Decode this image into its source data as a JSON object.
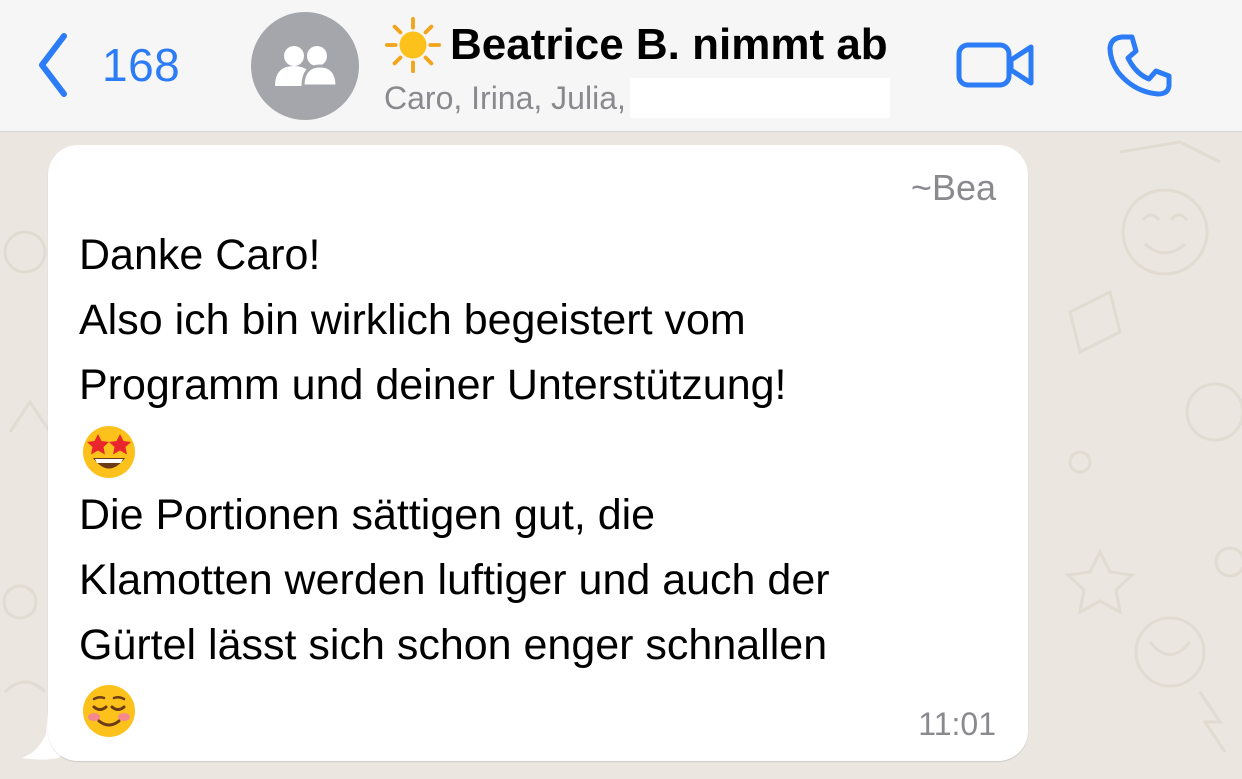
{
  "header": {
    "back_count": "168",
    "chat_title": "Beatrice B. nimmt ab",
    "title_emoji": "sun-emoji",
    "members_text": "Caro, Irina, Julia,",
    "avatar_icon": "group-icon"
  },
  "message": {
    "sender": "~Bea",
    "lines": [
      "Danke Caro!",
      "Also ich bin wirklich begeistert vom",
      "Programm und deiner Unterstützung!",
      "Die Portionen sättigen gut, die",
      "Klamotten werden luftiger und auch der",
      "Gürtel lässt sich schon enger schnallen"
    ],
    "emoji_1": "star-struck-emoji",
    "emoji_2": "smiling-face-emoji",
    "time": "11:01"
  },
  "colors": {
    "accent": "#2b7cf6",
    "header_bg": "#f6f6f6",
    "chat_bg": "#ebe6df",
    "bubble_bg": "#ffffff",
    "secondary_text": "#8a8a8e"
  }
}
